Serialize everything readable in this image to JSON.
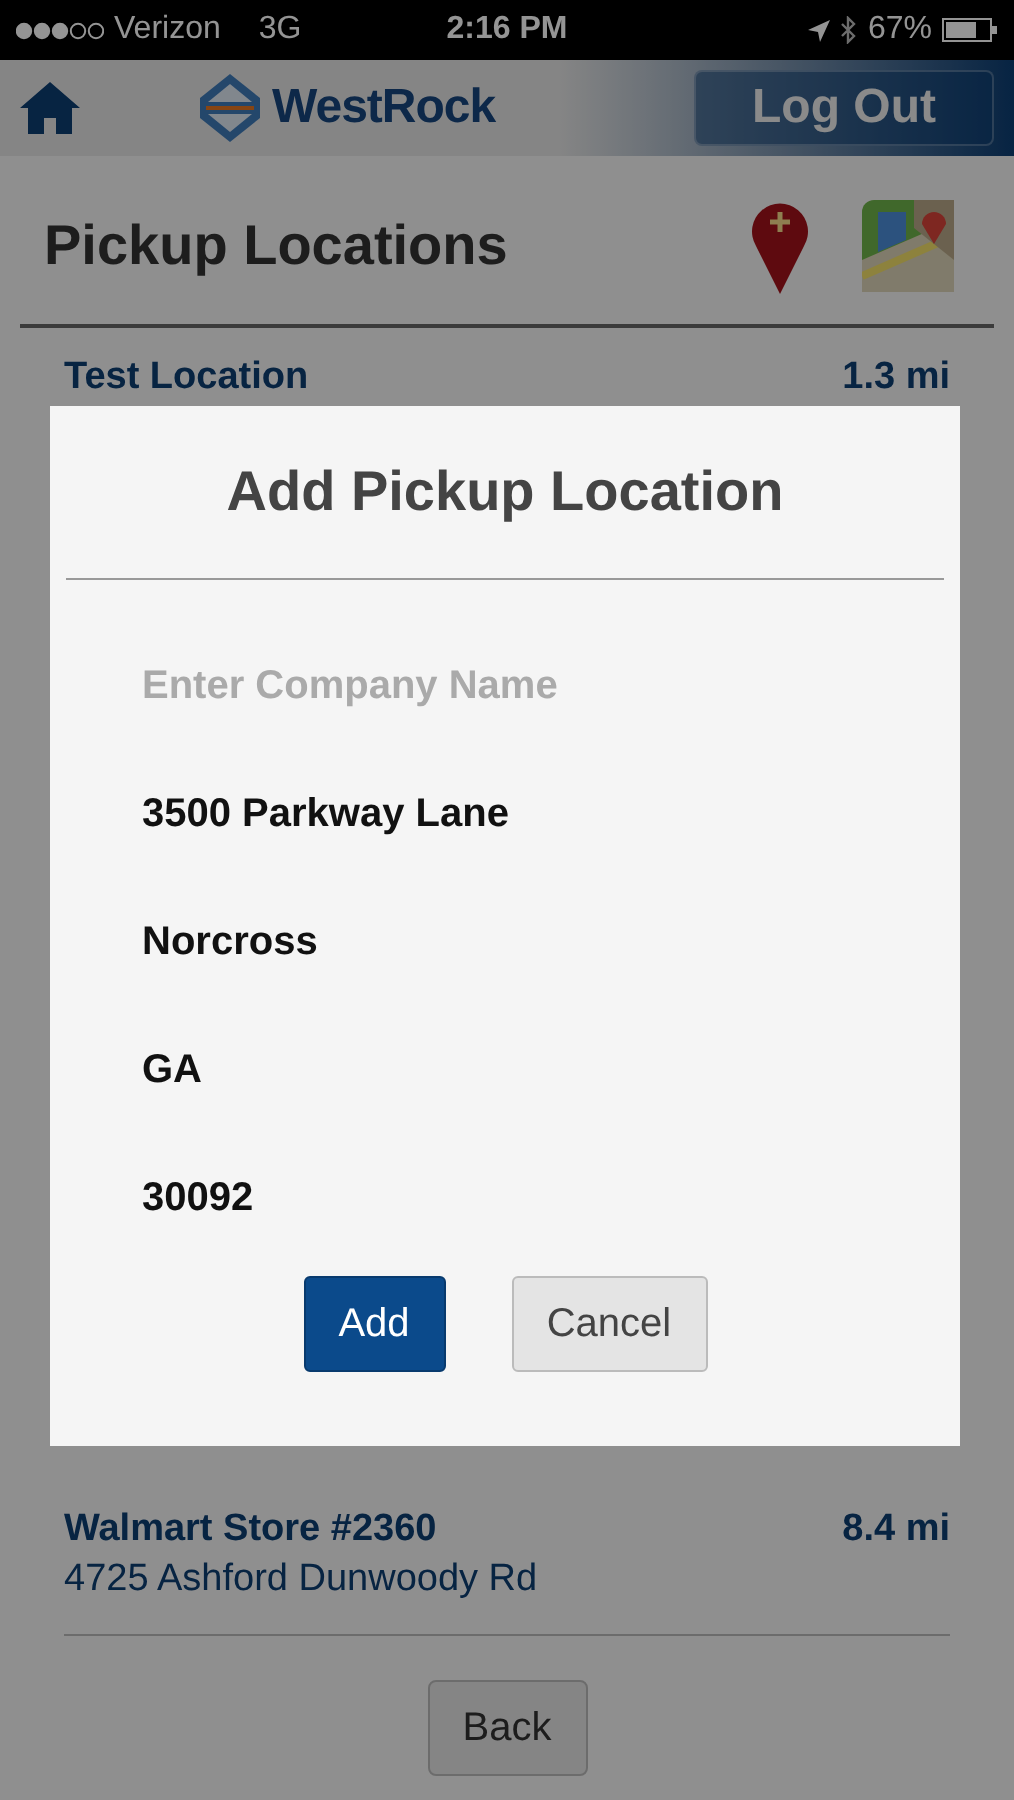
{
  "status_bar": {
    "carrier": "Verizon",
    "network": "3G",
    "time": "2:16 PM",
    "battery": "67%"
  },
  "header": {
    "logo_text": "WestRock",
    "logout": "Log Out"
  },
  "page": {
    "title": "Pickup Locations"
  },
  "locations": [
    {
      "name": "Test Location",
      "distance": "1.3 mi"
    },
    {
      "name": "Walmart Store #2360",
      "distance": "8.4 mi",
      "address": "4725 Ashford Dunwoody Rd"
    }
  ],
  "back_button": "Back",
  "dialog": {
    "title": "Add Pickup Location",
    "fields": [
      {
        "placeholder": "Enter Company Name"
      },
      {
        "value": "3500 Parkway Lane"
      },
      {
        "value": "Norcross"
      },
      {
        "value": "GA"
      },
      {
        "value": "30092"
      }
    ],
    "buttons": [
      {
        "label": "Add",
        "kind": "primary"
      },
      {
        "label": "Cancel",
        "kind": "secondary"
      }
    ]
  }
}
